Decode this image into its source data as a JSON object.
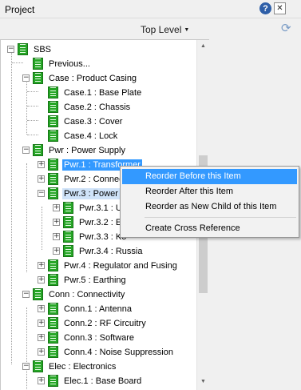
{
  "window": {
    "title": "Project",
    "help_label": "?",
    "close_label": "✕"
  },
  "toolbar": {
    "level_label": "Top Level",
    "dropdown_arrow": "▼",
    "refresh_icon": "⟳"
  },
  "tree": {
    "items": [
      {
        "label": "SBS",
        "expander": "−"
      },
      {
        "label": "Previous...",
        "expander": ""
      },
      {
        "label": "Case : Product Casing",
        "expander": "−"
      },
      {
        "label": "Case.1 : Base Plate",
        "expander": ""
      },
      {
        "label": "Case.2 : Chassis",
        "expander": ""
      },
      {
        "label": "Case.3 : Cover",
        "expander": ""
      },
      {
        "label": "Case.4 : Lock",
        "expander": ""
      },
      {
        "label": "Pwr : Power Supply",
        "expander": "−"
      },
      {
        "label": "Pwr.1 : Transformer",
        "expander": "+"
      },
      {
        "label": "Pwr.2 : Connec",
        "expander": "+"
      },
      {
        "label": "Pwr.3 : Power C",
        "expander": "−"
      },
      {
        "label": "Pwr.3.1 : UI",
        "expander": "+"
      },
      {
        "label": "Pwr.3.2 : EU",
        "expander": "+"
      },
      {
        "label": "Pwr.3.3 : Ko",
        "expander": "+"
      },
      {
        "label": "Pwr.3.4 : Russia",
        "expander": "+"
      },
      {
        "label": "Pwr.4 : Regulator and Fusing",
        "expander": "+"
      },
      {
        "label": "Pwr.5 : Earthing",
        "expander": "+"
      },
      {
        "label": "Conn : Connectivity",
        "expander": "−"
      },
      {
        "label": "Conn.1 : Antenna",
        "expander": "+"
      },
      {
        "label": "Conn.2 : RF Circuitry",
        "expander": "+"
      },
      {
        "label": "Conn.3 : Software",
        "expander": "+"
      },
      {
        "label": "Conn.4 : Noise Suppression",
        "expander": "+"
      },
      {
        "label": "Elec : Electronics",
        "expander": "−"
      },
      {
        "label": "Elec.1 : Base Board",
        "expander": "+"
      }
    ]
  },
  "context_menu": {
    "items": [
      {
        "label": "Reorder Before this Item"
      },
      {
        "label": "Reorder After this Item"
      },
      {
        "label": "Reorder as New Child of this Item"
      },
      {
        "label": "Create Cross Reference"
      }
    ]
  },
  "scrollbar": {
    "up_arrow": "▲",
    "down_arrow": "▼"
  },
  "colors": {
    "selection": "#3399ff",
    "highlight": "#cfe3f9",
    "doc_icon": "#26a526"
  }
}
